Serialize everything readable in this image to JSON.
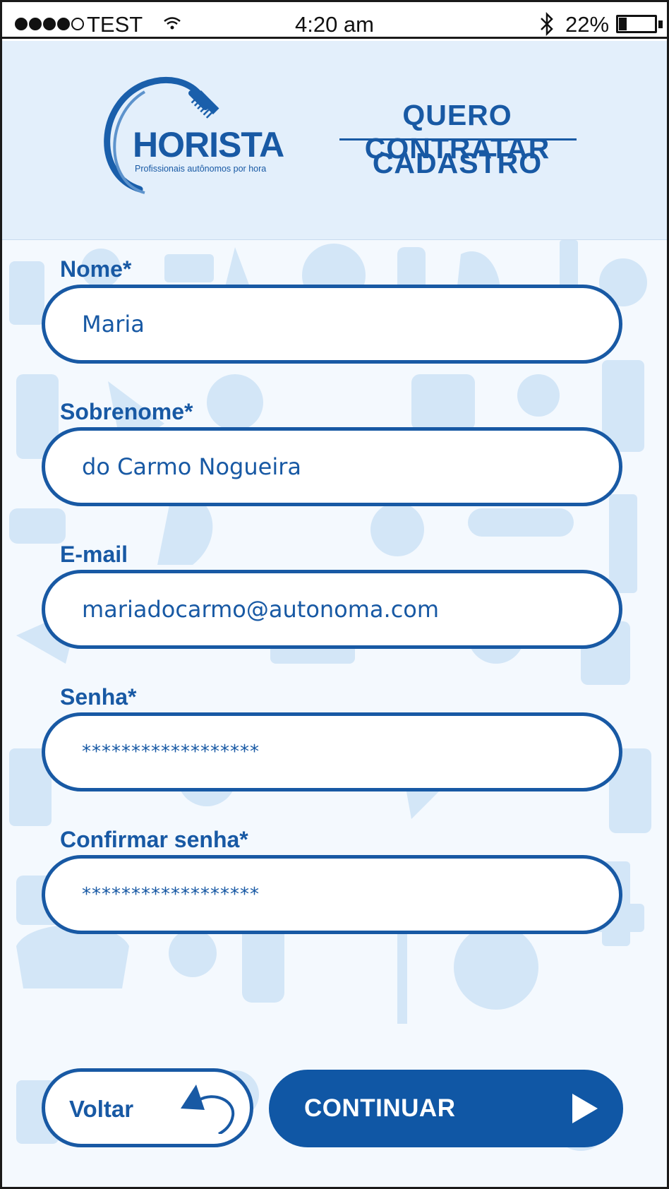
{
  "status_bar": {
    "carrier": "TEST",
    "signal_bars_filled": 4,
    "signal_bars_total": 5,
    "time": "4:20 am",
    "battery_percent": "22%",
    "battery_level": 0.22
  },
  "header": {
    "logo_word": "HORISTA",
    "logo_tagline": "Profissionais autônomos por hora",
    "title": "QUERO CONTRATAR",
    "subtitle": "CADASTRO"
  },
  "form": {
    "fields": [
      {
        "label": "Nome*",
        "value": "Maria"
      },
      {
        "label": "Sobrenome*",
        "value": "do Carmo Nogueira"
      },
      {
        "label": "E-mail",
        "value": "mariadocarmo@autonoma.com"
      },
      {
        "label": "Senha*",
        "value": "******************"
      },
      {
        "label": "Confirmar senha*",
        "value": "******************"
      }
    ]
  },
  "actions": {
    "back_label": "Voltar",
    "continue_label": "CONTINUAR"
  },
  "colors": {
    "brand_blue": "#1859a4",
    "header_bg": "#e3effb",
    "pattern_blue": "#d3e6f7"
  },
  "icons": {
    "signal": "signal-dots-icon",
    "wifi": "wifi-icon",
    "bluetooth": "bluetooth-icon",
    "battery": "battery-icon",
    "back": "back-arrow-icon",
    "continue": "play-arrow-icon"
  }
}
